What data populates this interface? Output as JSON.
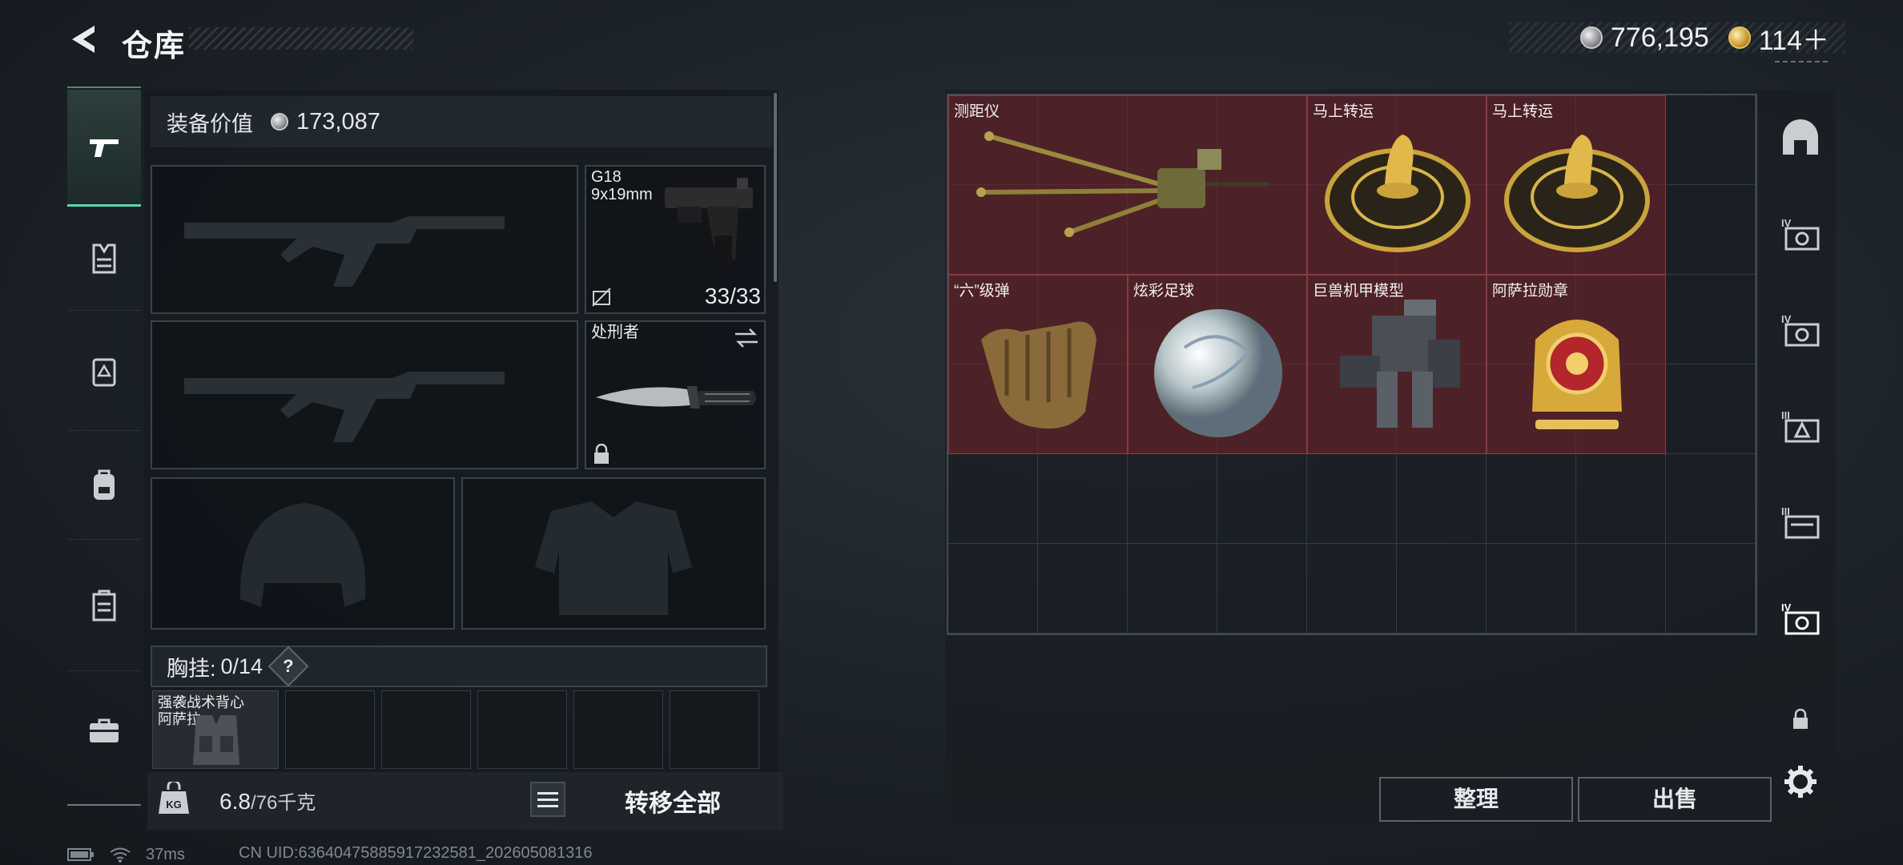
{
  "header": {
    "title": "仓库",
    "currencies": [
      {
        "icon": "silver-coin-icon",
        "value": "776,195"
      },
      {
        "icon": "gold-coin-icon",
        "value": "114＋"
      }
    ]
  },
  "left_nav": {
    "items": [
      {
        "name": "weapons",
        "icon": "pistol-icon",
        "active": true
      },
      {
        "name": "armor",
        "icon": "vest-icon",
        "active": false
      },
      {
        "name": "chest-rig",
        "icon": "rig-icon",
        "active": false
      },
      {
        "name": "backpack",
        "icon": "backpack-icon",
        "active": false
      },
      {
        "name": "container",
        "icon": "container-icon",
        "active": false
      },
      {
        "name": "toolbox",
        "icon": "toolbox-icon",
        "active": false
      }
    ]
  },
  "equipment": {
    "value_label": "装备价值",
    "value": "173,087",
    "pistol": {
      "name": "G18",
      "caliber": "9x19mm",
      "ammo": "33/33"
    },
    "melee": {
      "name": "处刑者"
    },
    "chest": {
      "label": "胸挂:",
      "count": "0/14",
      "help": "?"
    },
    "vest_item": {
      "line1": "强袭战术背心",
      "line2": "阿萨拉"
    },
    "weight": {
      "current": "6.8",
      "max": "/76千克"
    },
    "transfer_all": "转移全部"
  },
  "stash": {
    "items": [
      {
        "label": "测距仪",
        "icon": "rangefinder-icon"
      },
      {
        "label": "马上转运",
        "icon": "horse-coin-icon"
      },
      {
        "label": "马上转运",
        "icon": "horse-coin-icon"
      },
      {
        "label": "“六”级弹",
        "icon": "bullet-hand-icon"
      },
      {
        "label": "炫彩足球",
        "icon": "football-icon"
      },
      {
        "label": "巨兽机甲模型",
        "icon": "mech-model-icon"
      },
      {
        "label": "阿萨拉勋章",
        "icon": "medal-icon"
      }
    ],
    "sort_label": "整理",
    "sell_label": "出售"
  },
  "right_nav": {
    "items": [
      "bunker-icon",
      "storage-iv-icon",
      "storage-iv-icon",
      "storage-iii-icon",
      "storage-iii-icon",
      "storage-iv-icon",
      "lock-icon",
      "gear-icon"
    ]
  },
  "status": {
    "ping": "37ms",
    "uid": "CN UID:636404758859172325​81_202605081316"
  },
  "colors": {
    "accent": "#57d6b5",
    "item_bg": "#6e2228"
  }
}
